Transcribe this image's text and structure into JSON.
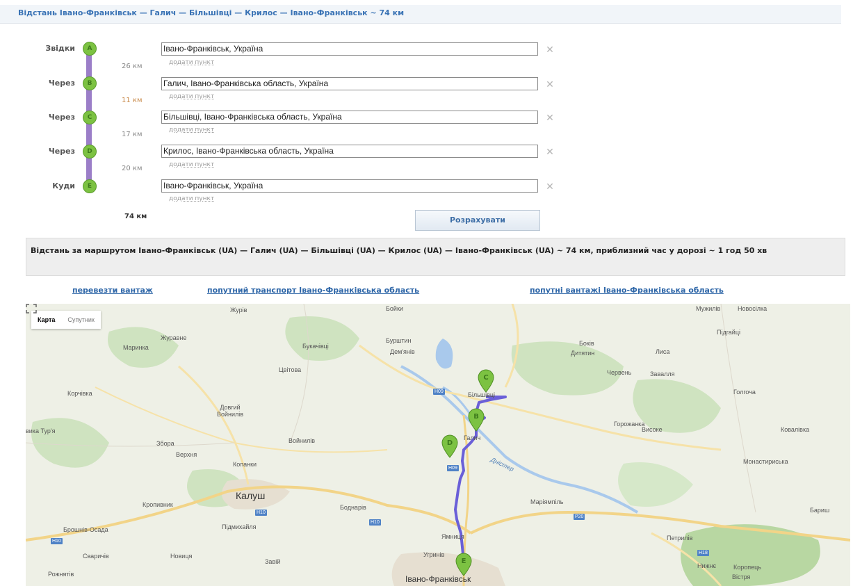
{
  "header": {
    "title": "Відстань Івано-Франківськ — Галич — Більшівці — Крилос — Івано-Франківськ  ~ 74 км"
  },
  "route": {
    "rows": [
      {
        "label": "Звідки",
        "marker": "A",
        "value": "Івано-Франківськ, Україна"
      },
      {
        "label": "Через",
        "marker": "B",
        "value": "Галич, Івано-Франківська область, Україна"
      },
      {
        "label": "Через",
        "marker": "C",
        "value": "Більшівці, Івано-Франківська область, Україна"
      },
      {
        "label": "Через",
        "marker": "D",
        "value": "Крилос, Івано-Франківська область, Україна"
      },
      {
        "label": "Куди",
        "marker": "E",
        "value": "Івано-Франківськ, Україна"
      }
    ],
    "segments": [
      "26 км",
      "11 км",
      "17 км",
      "20 км"
    ],
    "add_point_label": "додати пункт",
    "total": "74 км",
    "calc_button": "Розрахувати",
    "marker_color": "#7cc242",
    "line_color": "#9b7ec8"
  },
  "result": {
    "text": "Відстань за маршрутом Івано-Франківськ (UA) — Галич (UA) — Більшівці (UA) — Крилос (UA) — Івано-Франківськ (UA) ~ 74 км, приблизний час у дорозі ~ 1 год 50 хв"
  },
  "links": [
    "перевезти вантаж",
    "попутний транспорт Івано-Франківська область",
    "попутні вантажі Івано-Франківська область"
  ],
  "map": {
    "type_active": "Карта",
    "type_inactive": "Супутник",
    "route_color": "#6a5fd8",
    "pins": [
      "C",
      "B",
      "D",
      "E"
    ],
    "labels": {
      "zhuriv": "Журів",
      "boyky": "Бойки",
      "munylia": "Мужилів",
      "novosilka": "Новосілка",
      "pidhaitsi": "Підгайці",
      "zhuravne": "Журавне",
      "marynka": "Маринка",
      "bukachivtsi": "Букачівці",
      "burshtyn": "Бурштин",
      "demianiv": "Дем'янів",
      "bokiv": "Боків",
      "dytiatyn": "Дитятин",
      "lysa": "Лиса",
      "tsvitova": "Цвітова",
      "cherven": "Червень",
      "zavalie": "Завалля",
      "korchivka": "Корчівка",
      "bilshivtsi": "Більшівці",
      "holhocha": "Голгоча",
      "dovhyi": "Довгий Войнилів",
      "horozhanka": "Горожанка",
      "vysoke": "Високе",
      "kovalivka": "Ковалівка",
      "tura": "вика Тур'я",
      "zbora": "Збора",
      "voinyliv": "Войнилів",
      "halych": "Галич",
      "verkhnia": "Верхня",
      "kopanky": "Копанки",
      "monastyryska": "Монастириська",
      "dnister": "Дністер",
      "kalush": "Калуш",
      "kropyvnyk": "Кропивник",
      "bodnariv": "Боднарів",
      "mariiampil": "Маріямпіль",
      "barysh": "Бариш",
      "broshniv": "Брошнів-Осада",
      "pidmykhailia": "Підмихайля",
      "yamnytsia": "Ямниця",
      "petryliv": "Петрилів",
      "svarychiv": "Сваричів",
      "novytsia": "Новиця",
      "zaviy": "Завій",
      "uhryniv": "Угринів",
      "nyzhnie": "Нижнє",
      "koropets": "Коропець",
      "rozhniativ": "Рожнятів",
      "ivano": "Івано-Франківськ",
      "vistria": "Вістря"
    },
    "roads": {
      "h09": "H09",
      "h10a": "H10",
      "h10b": "H10",
      "h10c": "H10",
      "p20": "P20",
      "h18": "H18",
      "h09b": "H09"
    }
  }
}
